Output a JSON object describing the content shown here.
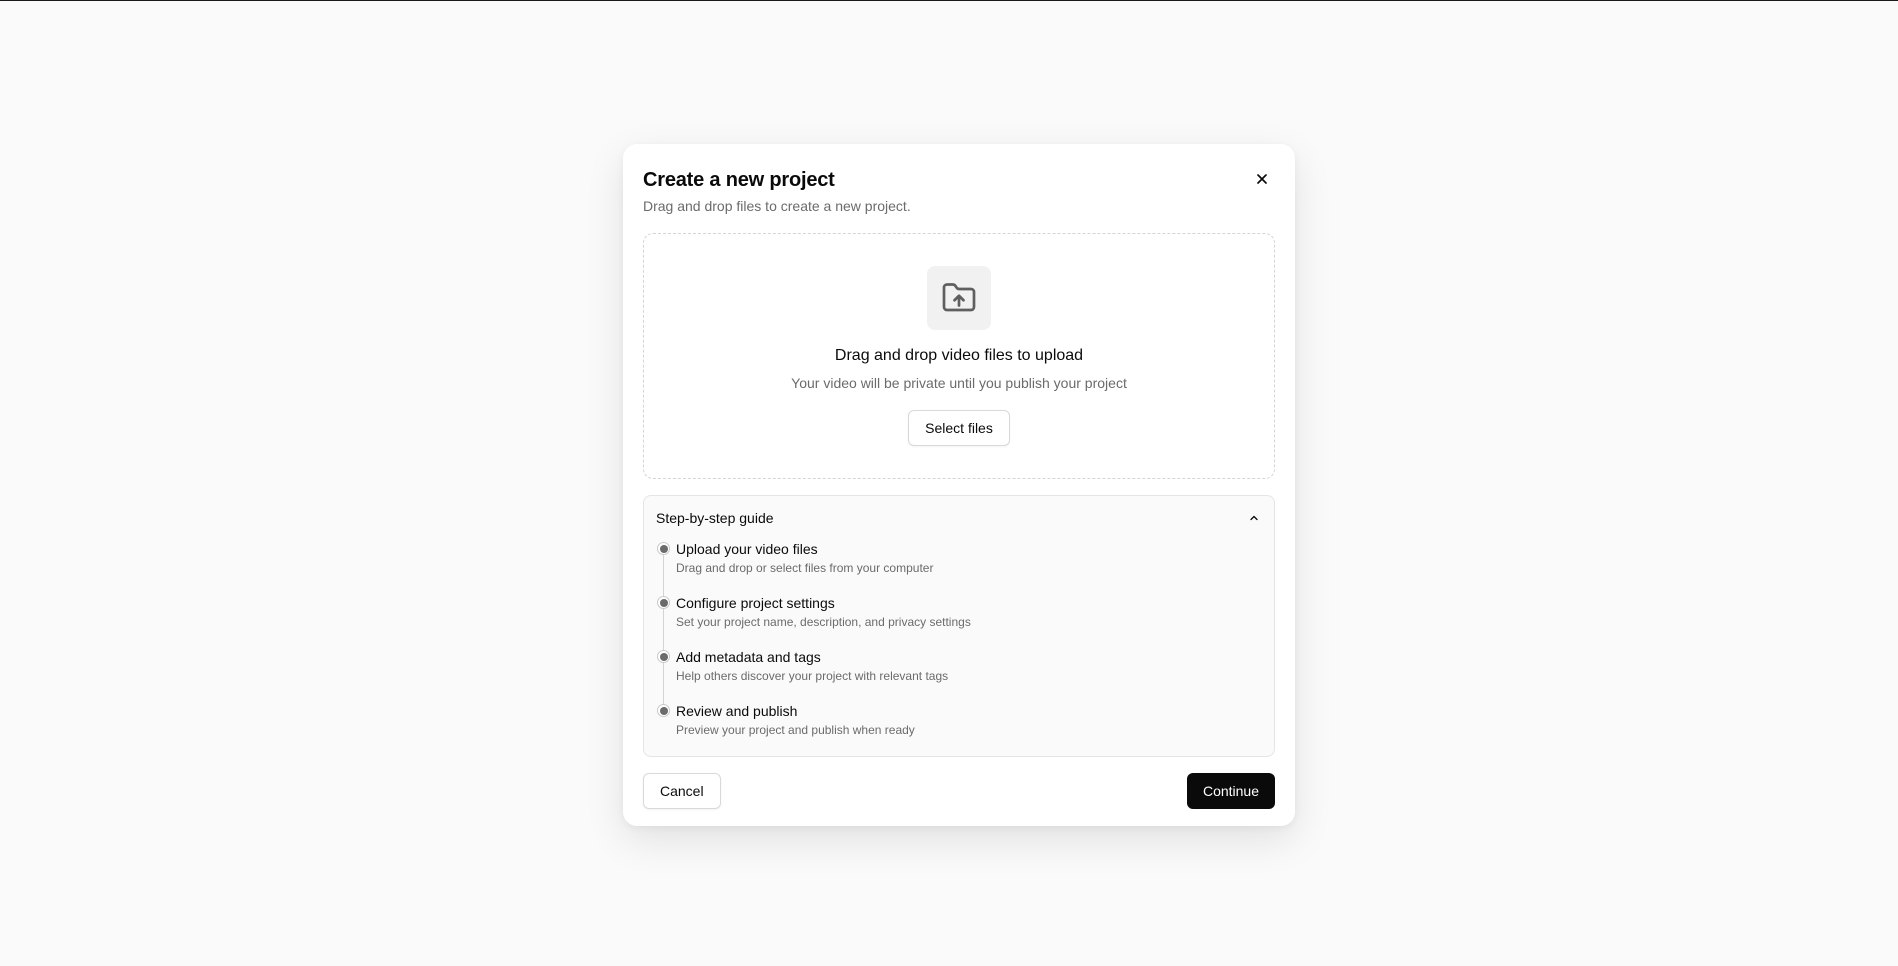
{
  "dialog": {
    "title": "Create a new project",
    "subtitle": "Drag and drop files to create a new project.",
    "close_icon": "close-icon"
  },
  "dropzone": {
    "icon": "folder-upload-icon",
    "title": "Drag and drop video files to upload",
    "subtitle": "Your video will be private until you publish your project",
    "select_label": "Select files"
  },
  "guide": {
    "title": "Step-by-step guide",
    "toggle_icon": "chevron-up-icon",
    "steps": [
      {
        "title": "Upload your video files",
        "description": "Drag and drop or select files from your computer"
      },
      {
        "title": "Configure project settings",
        "description": "Set your project name, description, and privacy settings"
      },
      {
        "title": "Add metadata and tags",
        "description": "Help others discover your project with relevant tags"
      },
      {
        "title": "Review and publish",
        "description": "Preview your project and publish when ready"
      }
    ]
  },
  "footer": {
    "cancel_label": "Cancel",
    "continue_label": "Continue"
  },
  "colors": {
    "background": "#fafafa",
    "primary": "#0a0a0a",
    "muted_text": "#6b6b6b",
    "border": "#e5e5e5"
  }
}
